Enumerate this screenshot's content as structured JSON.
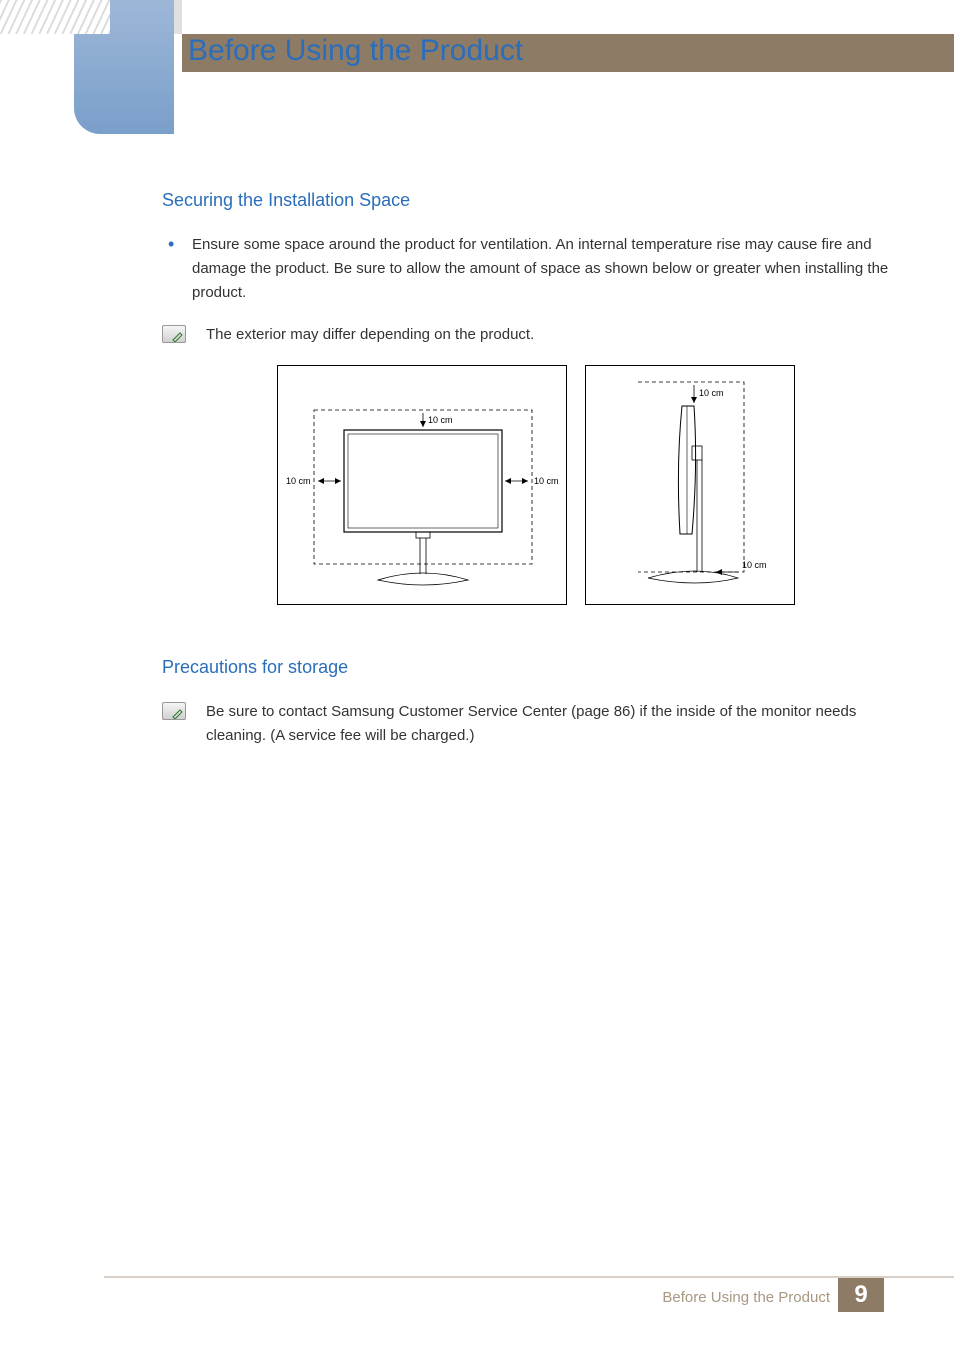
{
  "header": {
    "title": "Before Using the Product"
  },
  "sections": {
    "securing": {
      "heading": "Securing the Installation Space",
      "bullet": "Ensure some space around the product for ventilation. An internal temperature rise may cause fire and damage the product. Be sure to allow the amount of space as shown below or greater when installing the product.",
      "note": "The exterior may differ depending on the product."
    },
    "precautions": {
      "heading": "Precautions for storage",
      "note": "Be sure to contact Samsung Customer Service Center (page 86) if the inside of the monitor needs cleaning. (A service fee will be charged.)"
    }
  },
  "diagram": {
    "top_label": "10 cm",
    "left_label": "10 cm",
    "right_label": "10 cm",
    "side_top_label": "10 cm",
    "side_bottom_label": "10 cm"
  },
  "footer": {
    "chapter": "Before Using the Product",
    "page": "9"
  }
}
